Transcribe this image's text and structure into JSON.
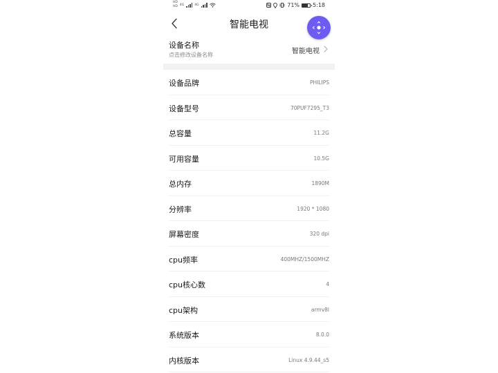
{
  "status_bar": {
    "sim1_label": "HD",
    "sim2_label": "HD",
    "net1": "4G",
    "net2": "4G",
    "battery_percent": "71%",
    "battery_level": 0.71,
    "time": "5:18"
  },
  "header": {
    "title": "智能电视"
  },
  "device_name": {
    "label": "设备名称",
    "hint": "点击修改设备名称",
    "value": "智能电视"
  },
  "info": [
    {
      "label": "设备品牌",
      "value": "PHILIPS"
    },
    {
      "label": "设备型号",
      "value": "70PUF7295_T3"
    },
    {
      "label": "总容量",
      "value": "11.2G"
    },
    {
      "label": "可用容量",
      "value": "10.5G"
    },
    {
      "label": "总内存",
      "value": "1890M"
    },
    {
      "label": "分辨率",
      "value": "1920 * 1080"
    },
    {
      "label": "屏幕密度",
      "value": "320 dpi"
    },
    {
      "label": "cpu频率",
      "value": "400MHZ/1500MHZ"
    },
    {
      "label": "cpu核心数",
      "value": "4"
    },
    {
      "label": "cpu架构",
      "value": "armv8l"
    },
    {
      "label": "系统版本",
      "value": "8.0.0"
    },
    {
      "label": "内核版本",
      "value": "Linux 4.9.44_s5"
    }
  ],
  "colors": {
    "fab": "#6e5cf2",
    "separator": "#f2f2f2"
  },
  "icons": {
    "back": "chevron-left-icon",
    "fab": "remote-dpad-icon",
    "row_chevron": "chevron-right-icon"
  }
}
